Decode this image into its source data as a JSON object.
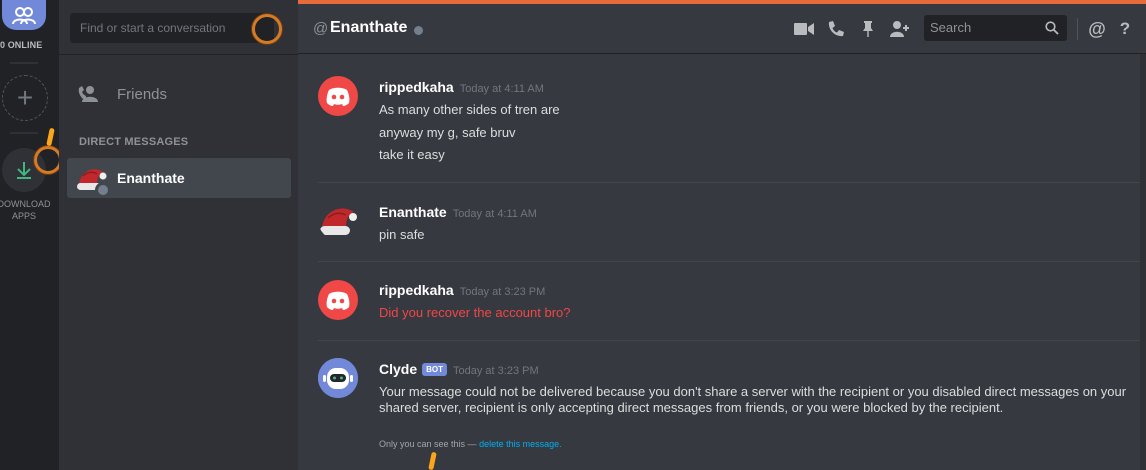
{
  "servers": {
    "online_label": "0 ONLINE",
    "add_server": "+",
    "download_label_1": "DOWNLOAD",
    "download_label_2": "APPS"
  },
  "dm_sidebar": {
    "search_placeholder": "Find or start a conversation",
    "friends_label": "Friends",
    "section_header": "DIRECT MESSAGES",
    "conversations": [
      {
        "name": "Enanthate",
        "status": "offline",
        "selected": true
      }
    ]
  },
  "header": {
    "at_symbol": "@",
    "channel_name": "Enanthate",
    "search_placeholder": "Search",
    "icons": [
      "video-call-icon",
      "voice-call-icon",
      "pin-icon",
      "add-friend-icon",
      "search-icon",
      "mentions-icon",
      "help-icon"
    ],
    "mentions_glyph": "@",
    "help_glyph": "?"
  },
  "messages": [
    {
      "author": "rippedkaha",
      "timestamp": "Today at 4:11 AM",
      "avatar": "discord-logo-red",
      "lines": [
        "As many other sides of tren are",
        "anyway my g, safe bruv",
        "take it easy"
      ]
    },
    {
      "author": "Enanthate",
      "timestamp": "Today at 4:11 AM",
      "avatar": "santa-hat",
      "lines": [
        "pin safe"
      ]
    },
    {
      "author": "rippedkaha",
      "timestamp": "Today at 3:23 PM",
      "avatar": "discord-logo-red",
      "lines": [
        "Did you recover the account bro?"
      ],
      "failed": true
    },
    {
      "author": "Clyde",
      "bot_tag": "BOT",
      "timestamp": "Today at 3:23 PM",
      "avatar": "clyde-bot",
      "text": "Your message could not be delivered because you don't share a server with the recipient or you disabled direct messages on your shared server, recipient is only accepting direct messages from friends, or you were blocked by the recipient.",
      "only_you_prefix": "Only you can see this —",
      "delete_link": "delete this message."
    }
  ],
  "colors": {
    "accent": "#7289da",
    "error_text": "#f04747",
    "link": "#00b0f4",
    "tutorial": "#faa61a",
    "topline": "#e8693c"
  }
}
